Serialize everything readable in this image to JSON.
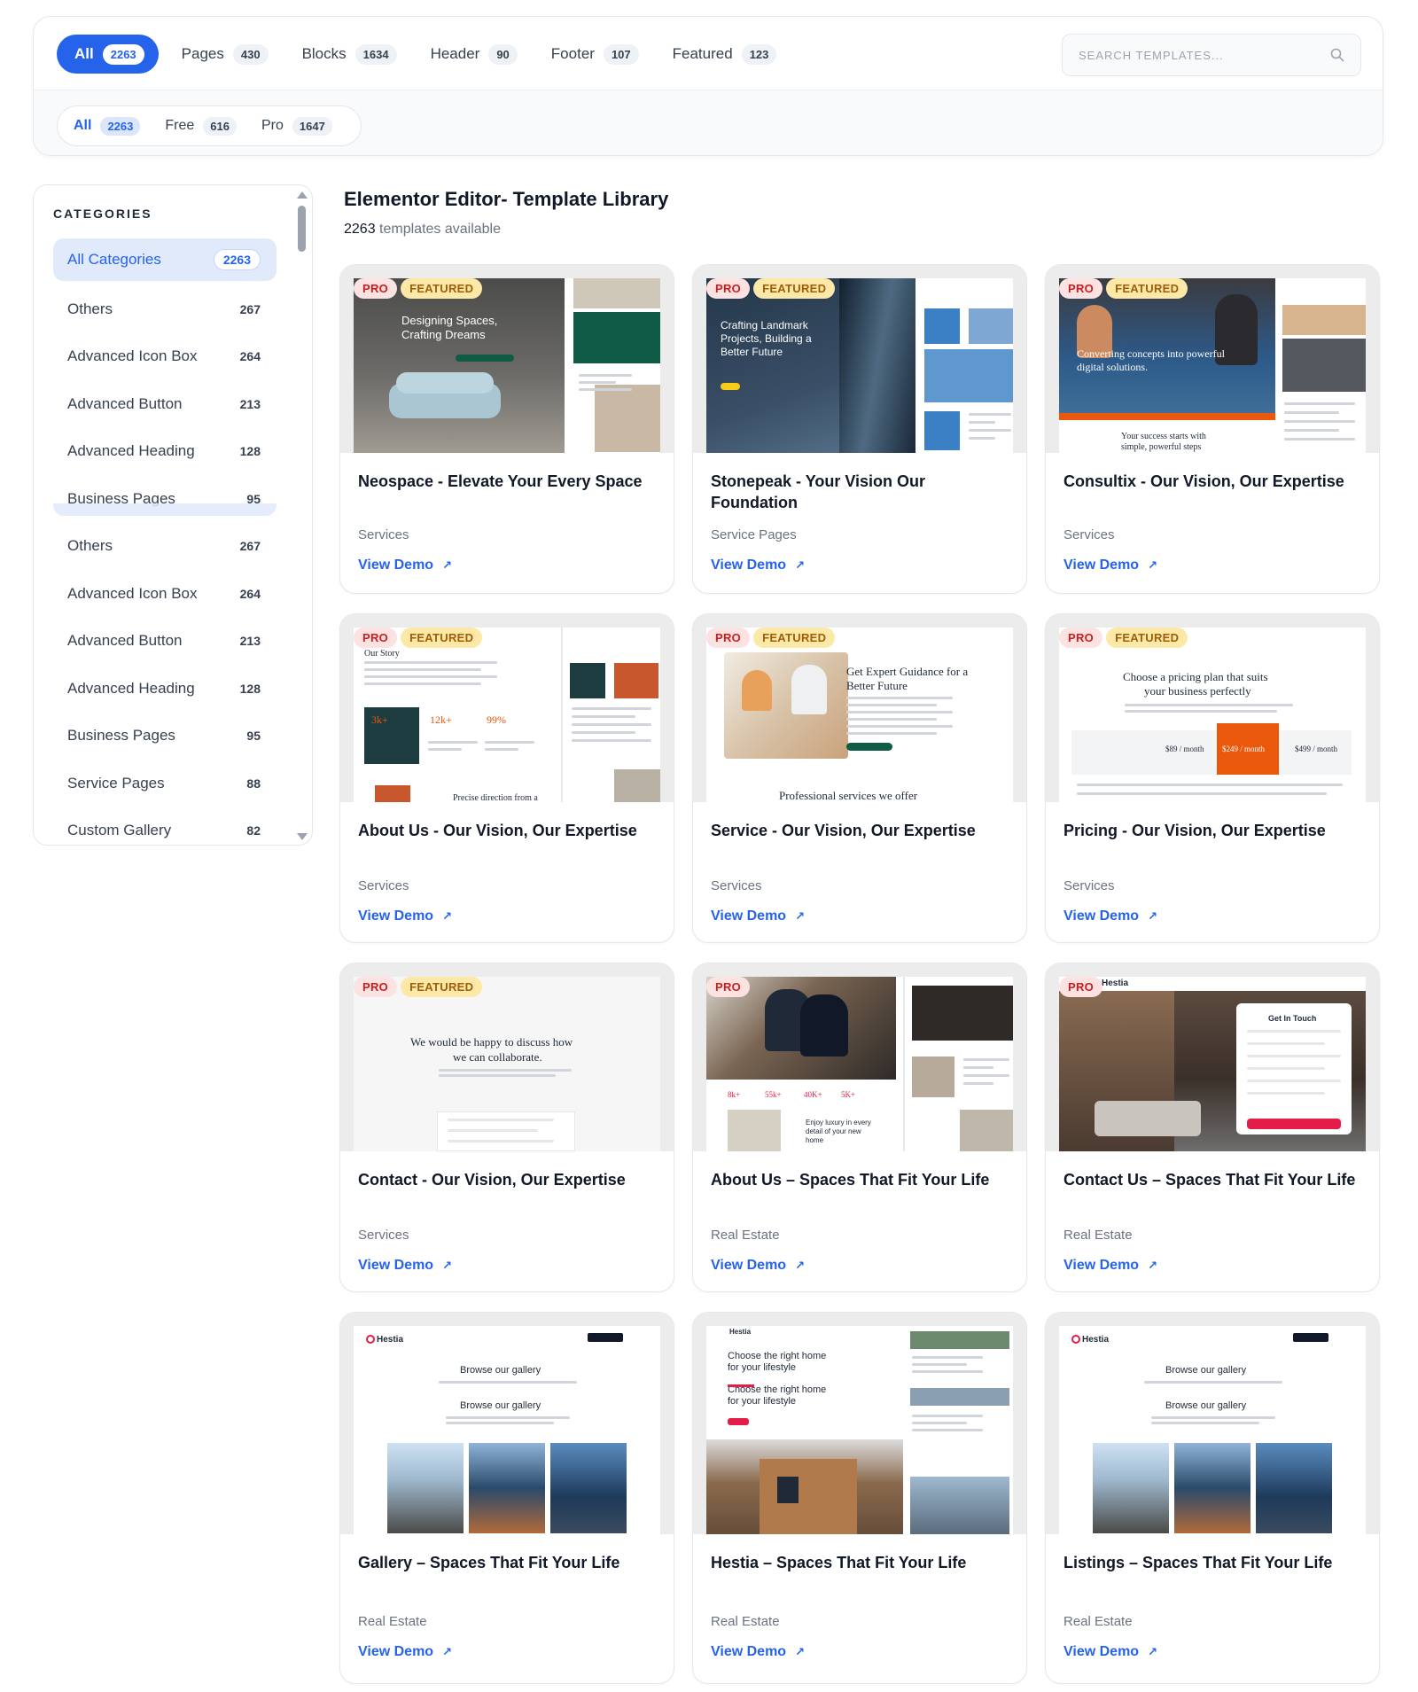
{
  "type_tabs": [
    {
      "label": "All",
      "count": "2263"
    },
    {
      "label": "Pages",
      "count": "430"
    },
    {
      "label": "Blocks",
      "count": "1634"
    },
    {
      "label": "Header",
      "count": "90"
    },
    {
      "label": "Footer",
      "count": "107"
    },
    {
      "label": "Featured",
      "count": "123"
    }
  ],
  "search": {
    "placeholder": "SEARCH TEMPLATES..."
  },
  "license_tabs": [
    {
      "label": "All",
      "count": "2263"
    },
    {
      "label": "Free",
      "count": "616"
    },
    {
      "label": "Pro",
      "count": "1647"
    }
  ],
  "sidebar": {
    "heading": "CATEGORIES",
    "items": [
      {
        "label": "All Categories",
        "count": "2263"
      },
      {
        "label": "Others",
        "count": "267"
      },
      {
        "label": "Advanced Icon Box",
        "count": "264"
      },
      {
        "label": "Advanced Button",
        "count": "213"
      },
      {
        "label": "Advanced Heading",
        "count": "128"
      },
      {
        "label": "Business Pages",
        "count": "95"
      },
      {
        "label": "Others",
        "count": "267"
      },
      {
        "label": "Advanced Icon Box",
        "count": "264"
      },
      {
        "label": "Advanced Button",
        "count": "213"
      },
      {
        "label": "Advanced Heading",
        "count": "128"
      },
      {
        "label": "Business Pages",
        "count": "95"
      },
      {
        "label": "Service Pages",
        "count": "88"
      },
      {
        "label": "Custom Gallery",
        "count": "82"
      }
    ]
  },
  "main": {
    "title": "Elementor Editor- Template Library",
    "count": "2263",
    "count_suffix": " templates available"
  },
  "badges": {
    "pro": "PRO",
    "featured": "FEATURED"
  },
  "view_demo": "View Demo",
  "cards": [
    {
      "title": "Neospace - Elevate Your Every Space",
      "category": "Services",
      "pro": true,
      "featured": true,
      "thumb_text": [
        "Designing Spaces,",
        "Crafting Dreams"
      ]
    },
    {
      "title": "Stonepeak - Your Vision Our Foundation",
      "category": "Service Pages",
      "pro": true,
      "featured": true,
      "thumb_text": [
        "Crafting Landmark",
        "Projects, Building a",
        "Better Future"
      ]
    },
    {
      "title": "Consultix - Our Vision, Our Expertise",
      "category": "Services",
      "pro": true,
      "featured": true,
      "thumb_text": [
        "Converting concepts into powerful",
        "digital solutions.",
        "Your success starts with",
        "simple, powerful steps"
      ]
    },
    {
      "title": "About Us - Our Vision, Our Expertise",
      "category": "Services",
      "pro": true,
      "featured": true,
      "thumb_text": [
        "Our Story",
        "3k+",
        "12k+",
        "99%",
        "Precise direction from a"
      ]
    },
    {
      "title": "Service - Our Vision, Our Expertise",
      "category": "Services",
      "pro": true,
      "featured": true,
      "thumb_text": [
        "Get Expert Guidance for a",
        "Better Future",
        "Professional services we offer"
      ]
    },
    {
      "title": "Pricing - Our Vision, Our Expertise",
      "category": "Services",
      "pro": true,
      "featured": true,
      "thumb_text": [
        "Choose a pricing plan that suits",
        "your business perfectly",
        "$89 / month",
        "$249 / month",
        "$499 / month"
      ]
    },
    {
      "title": "Contact - Our Vision, Our Expertise",
      "category": "Services",
      "pro": true,
      "featured": true,
      "thumb_text": [
        "We would be happy to discuss how",
        "we can collaborate."
      ]
    },
    {
      "title": "About Us – Spaces That Fit Your Life",
      "category": "Real Estate",
      "pro": true,
      "featured": false,
      "thumb_text": [
        "8k+",
        "55k+",
        "40K+",
        "5K+",
        "Enjoy luxury in every",
        "detail of your new",
        "home"
      ]
    },
    {
      "title": "Contact Us – Spaces That Fit Your Life",
      "category": "Real Estate",
      "pro": true,
      "featured": false,
      "thumb_text": [
        "Hestia",
        "Get In Touch"
      ]
    },
    {
      "title": "Gallery – Spaces That Fit Your Life",
      "category": "Real Estate",
      "pro": false,
      "featured": false,
      "thumb_text": [
        "Hestia",
        "Browse our gallery",
        "Browse our gallery"
      ]
    },
    {
      "title": "Hestia – Spaces That Fit Your Life",
      "category": "Real Estate",
      "pro": false,
      "featured": false,
      "thumb_text": [
        "Hestia",
        "Choose the right home",
        "for your lifestyle",
        "Choose the right home",
        "for your lifestyle"
      ]
    },
    {
      "title": "Listings – Spaces That Fit Your Life",
      "category": "Real Estate",
      "pro": false,
      "featured": false,
      "thumb_text": [
        "Hestia",
        "Browse our gallery",
        "Browse our gallery"
      ]
    }
  ],
  "colors": {
    "accent": "#2563eb",
    "pro_badge": "#fde2e2",
    "featured_badge": "#fde9a7",
    "pricing_highlight": "#ea580c",
    "contact_button": "#e11d48"
  }
}
